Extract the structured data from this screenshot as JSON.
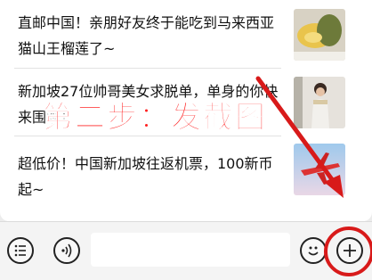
{
  "feed": {
    "items": [
      {
        "title": "直邮中国！亲朋好友终于能吃到马来西亚猫山王榴莲了~",
        "thumb_icon": "durian-photo"
      },
      {
        "title": "新加坡27位帅哥美女求脱单，单身的你快来围观！",
        "thumb_icon": "woman-portrait-photo"
      },
      {
        "title": "超低价！中国新加坡往返机票，100新币起~",
        "thumb_icon": "airplane-photo"
      }
    ]
  },
  "annotation": {
    "step_label": "第二步：发截图",
    "color": "#ff2020"
  },
  "input_bar": {
    "list_icon": "list-icon",
    "voice_icon": "voice-icon",
    "emoji_icon": "emoji-icon",
    "plus_icon": "plus-icon",
    "message_value": ""
  }
}
